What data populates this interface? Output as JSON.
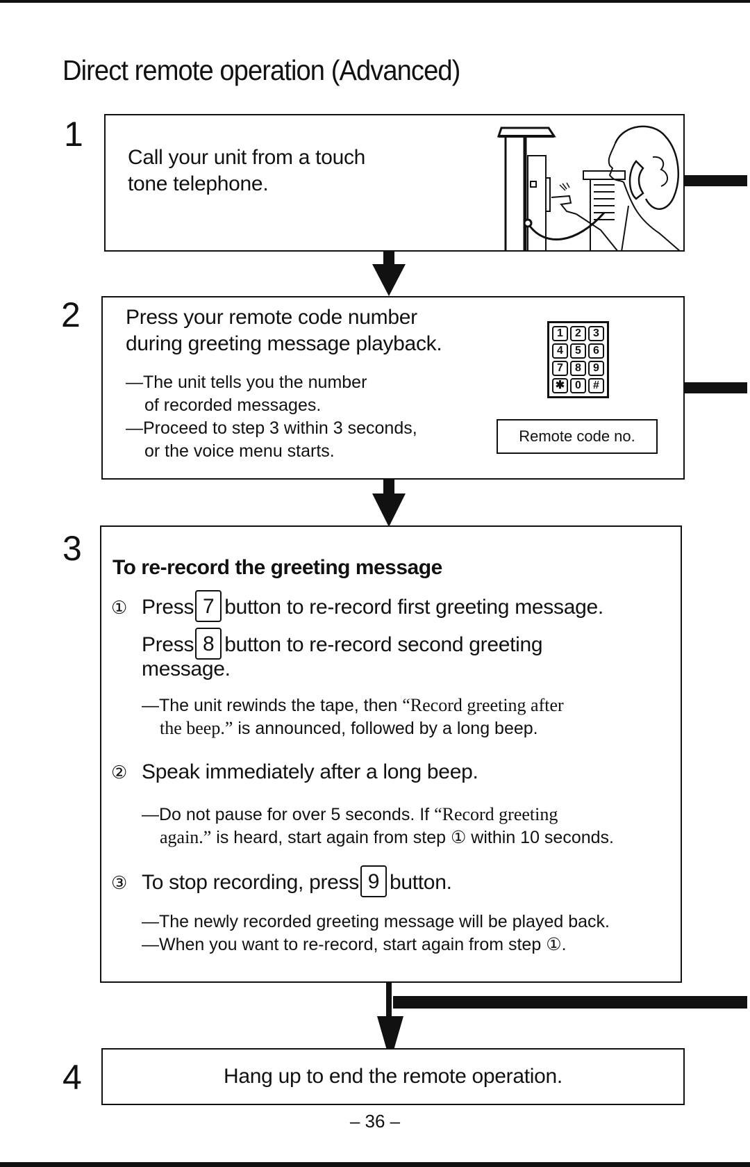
{
  "page": {
    "title": "Direct remote operation (Advanced)",
    "page_number": "– 36 –"
  },
  "steps": [
    {
      "number": "1",
      "text_lines": [
        "Call your unit from a touch",
        "tone telephone."
      ],
      "illustration": "woman-using-wall-telephone-illustration"
    },
    {
      "number": "2",
      "text_lines": [
        "Press your remote code number",
        "during greeting message playback."
      ],
      "notes": [
        [
          "—The unit tells you the number",
          "of recorded messages."
        ],
        [
          "—Proceed to step 3 within 3 seconds,",
          "or the voice menu starts."
        ]
      ],
      "keypad": [
        "1",
        "2",
        "3",
        "4",
        "5",
        "6",
        "7",
        "8",
        "9",
        "✱",
        "0",
        "#"
      ],
      "label": "Remote code no."
    },
    {
      "number": "3",
      "heading": "To re-record the greeting message",
      "substeps": [
        {
          "marker": "①",
          "line1_pre": "Press",
          "line1_key": "7",
          "line1_post": "button to re-record first greeting message.",
          "line2_pre": "Press",
          "line2_key": "8",
          "line2_post": "button to re-record second greeting",
          "line3": "message.",
          "note_a_pre": "—The unit rewinds the tape, then ",
          "note_a_serif": "“Record greeting after",
          "note_b_serif": "the beep.”",
          "note_b_post": " is announced, followed by a long beep."
        },
        {
          "marker": "②",
          "text": "Speak immediately after a long beep.",
          "note_a_pre": "—Do not pause for over 5 seconds. If ",
          "note_a_serif": "“Record greeting",
          "note_b_serif": "again.”",
          "note_b_post": " is heard, start again from step ① within 10 seconds."
        },
        {
          "marker": "③",
          "text_pre": "To stop recording, press",
          "key": "9",
          "text_post": "button.",
          "notes": [
            "—The newly recorded greeting message will be played back.",
            "—When you want to re-record, start again from step ①."
          ]
        }
      ]
    },
    {
      "number": "4",
      "text": "Hang up to end the remote operation."
    }
  ]
}
